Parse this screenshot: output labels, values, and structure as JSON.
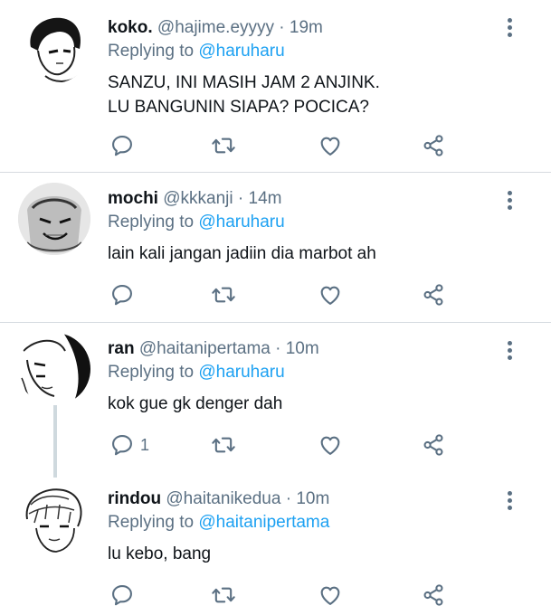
{
  "colors": {
    "text": "#0f1419",
    "muted": "#5b7083",
    "link": "#1da1f2",
    "divider": "#d6dbe0"
  },
  "tweets": [
    {
      "name": "koko.",
      "handle": "@hajime.eyyyy",
      "dot": "·",
      "time": "19m",
      "reply_prefix": "Replying to ",
      "reply_to": "@haruharu",
      "text_lines": [
        "SANZU, INI MASIH JAM 2 ANJINK.",
        "LU BANGUNIN SIAPA? POCICA?"
      ],
      "reply_count": ""
    },
    {
      "name": "mochi",
      "handle": "@kkkanji",
      "dot": "·",
      "time": "14m",
      "reply_prefix": "Replying to ",
      "reply_to": "@haruharu",
      "text_lines": [
        "lain kali jangan jadiin dia marbot ah"
      ],
      "reply_count": ""
    },
    {
      "name": "ran",
      "handle": "@haitanipertama",
      "dot": "·",
      "time": "10m",
      "reply_prefix": "Replying to ",
      "reply_to": "@haruharu",
      "text_lines": [
        "kok gue gk denger dah"
      ],
      "reply_count": "1"
    },
    {
      "name": "rindou",
      "handle": "@haitanikedua",
      "dot": "·",
      "time": "10m",
      "reply_prefix": "Replying to ",
      "reply_to": "@haitanipertama",
      "text_lines": [
        "lu kebo, bang"
      ],
      "reply_count": ""
    }
  ],
  "icons": {
    "reply": "reply-icon",
    "retweet": "retweet-icon",
    "like": "heart-icon",
    "share": "share-icon",
    "more": "more-vertical-icon"
  }
}
